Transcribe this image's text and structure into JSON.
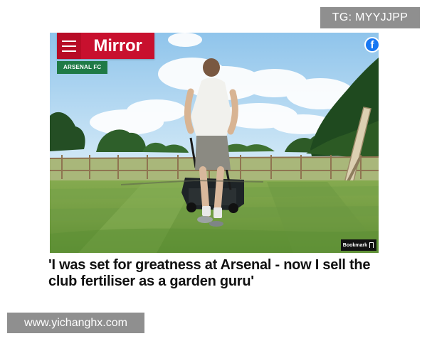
{
  "watermarks": {
    "top": "TG: MYYJJPP",
    "bottom": "www.yichanghx.com"
  },
  "article": {
    "brand": "Mirror",
    "section": "ARSENAL FC",
    "bookmark_label": "Bookmark",
    "headline": "'I was set for greatness at Arsenal - now I sell the club fertiliser as a garden guru'"
  },
  "icons": {
    "menu": "hamburger-menu-icon",
    "facebook": "facebook-icon",
    "bookmark": "bookmark-icon"
  },
  "colors": {
    "brand_red": "#c8102e",
    "section_green": "#1f7a46",
    "facebook_blue": "#1877f2",
    "headline": "#111111"
  }
}
